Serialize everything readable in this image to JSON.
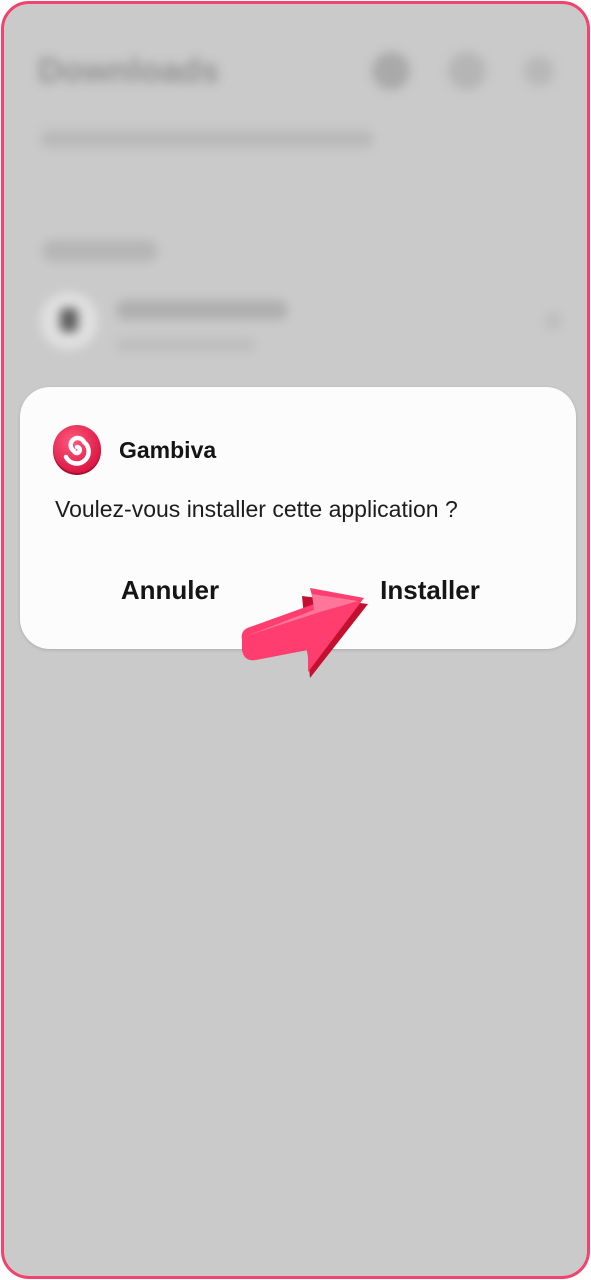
{
  "background_app": {
    "title": "Downloads"
  },
  "dialog": {
    "app_name": "Gambiva",
    "message": "Voulez-vous installer cette application ?",
    "cancel_label": "Annuler",
    "install_label": "Installer"
  },
  "icons": {
    "app_logo": "swirl-logo-icon",
    "pointer": "arrow-pointer-icon"
  },
  "colors": {
    "frame": "#f2426e",
    "overlay": "#cacaca",
    "dialog": "#fcfcfc",
    "arrow": "#ff3d6e"
  }
}
